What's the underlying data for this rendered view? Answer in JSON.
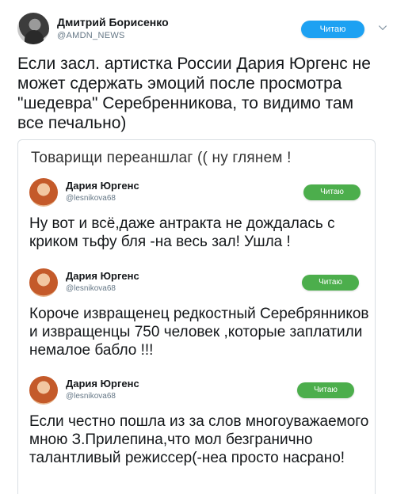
{
  "outer_tweet": {
    "author_name": "Дмитрий Борисенко",
    "author_handle": "@AMDN_NEWS",
    "follow_label": "Читаю",
    "text": "Если засл. артистка России Дария Юргенс не может сдержать эмоций после просмотра \"шедевра\" Серебренникова, то видимо там все печально)"
  },
  "card": {
    "title": "Товарищи переаншлаг (( ну глянем !",
    "replies": [
      {
        "author_name": "Дария Юргенс",
        "author_handle": "@lesnikova68",
        "follow_label": "Читаю",
        "text": "Ну вот и всё,даже антракта не дождалась с криком тьфу бля -на весь зал! Ушла !"
      },
      {
        "author_name": "Дария Юргенс",
        "author_handle": "@lesnikova68",
        "follow_label": "Читаю",
        "text": "Короче извращенец редкостный Серебрянников и извращенцы 750 человек ,которые заплатили немалое бабло !!!"
      },
      {
        "author_name": "Дария Юргенс",
        "author_handle": "@lesnikova68",
        "follow_label": "Читаю",
        "text": "Если честно пошла из за слов многоуважаемого мною З.Прилепина,что мол безгранично талантливый режиссер(-неа просто насрано!"
      }
    ]
  },
  "colors": {
    "follow_blue": "#1da1f2",
    "follow_green": "#4cae4c",
    "handle_gray": "#657786"
  },
  "icons": [
    "chevron-down-icon"
  ]
}
